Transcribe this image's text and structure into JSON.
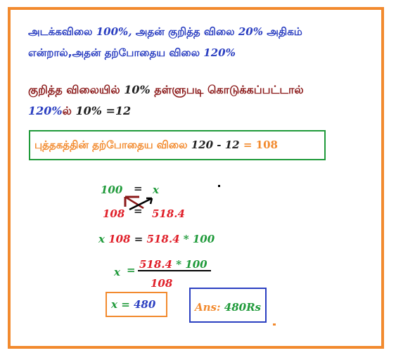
{
  "line1": {
    "prefix": "அடக்கவிலை",
    "v1": "100%,",
    "mid": "அதன் குறித்த விலை",
    "v2": "20%",
    "suffix": "அதிகம்"
  },
  "line2": {
    "prefix": "என்றால்,அதன் தற்போதைய விலை",
    "v": "120%"
  },
  "line3": {
    "prefix": "குறித்த விலையில்",
    "v": "10%",
    "suffix": "தள்ளுபடி கொடுக்கப்பட்டால்"
  },
  "line4": {
    "a": "120%",
    "b": "ல்",
    "c": "10% =12"
  },
  "box1": {
    "prefix": "புத்தகத்தின் தற்போதைய விலை",
    "expr": "120 - 12",
    "eq": "= 108"
  },
  "prop": {
    "n100": "100",
    "eq1": "=",
    "x": "x",
    "n108": "108",
    "eq2": "=",
    "n518": "518.4"
  },
  "eq_line": {
    "x": "x",
    "n108": "108",
    "eq": "=",
    "n518": "518.4",
    "rest": "* 100"
  },
  "frac": {
    "x": "x",
    "eq": "=",
    "num_a": "518.4",
    "num_b": "* 100",
    "den": "108"
  },
  "result": {
    "x": "x",
    "eq": "=",
    "val": "480"
  },
  "answer": {
    "label": "Ans:",
    "val": "480Rs"
  },
  "colors": {
    "orange": "#f28a2e",
    "green": "#1f9a3a",
    "blue": "#2b3fc1",
    "red": "#e0202a",
    "maroon": "#8b1a1a"
  }
}
